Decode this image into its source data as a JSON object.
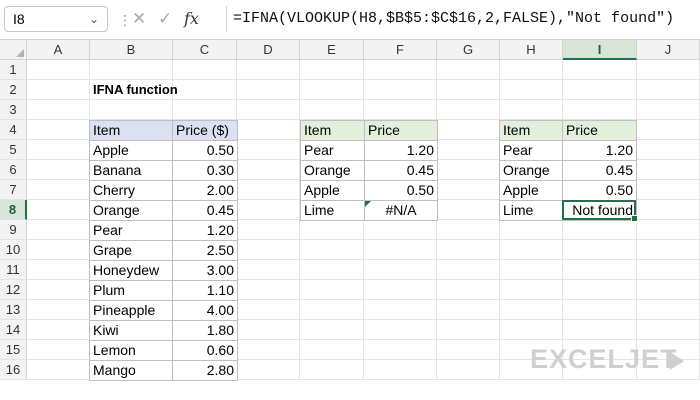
{
  "formula_bar": {
    "name_box": "I8",
    "name_box_icon": "chevron-down-icon",
    "cancel_icon": "x-icon",
    "enter_icon": "check-icon",
    "fx_icon": "fx",
    "formula": "=IFNA(VLOOKUP(H8,$B$5:$C$16,2,FALSE),\"Not found\")"
  },
  "columns": [
    "A",
    "B",
    "C",
    "D",
    "E",
    "F",
    "G",
    "H",
    "I",
    "J"
  ],
  "rows": [
    "1",
    "2",
    "3",
    "4",
    "5",
    "6",
    "7",
    "8",
    "9",
    "10",
    "11",
    "12",
    "13",
    "14",
    "15",
    "16"
  ],
  "active_cell": {
    "column": "I",
    "row": "8"
  },
  "sheet_title": "IFNA function",
  "table_prices": {
    "headers": [
      "Item",
      "Price ($)"
    ],
    "rows": [
      [
        "Apple",
        "0.50"
      ],
      [
        "Banana",
        "0.30"
      ],
      [
        "Cherry",
        "2.00"
      ],
      [
        "Orange",
        "0.45"
      ],
      [
        "Pear",
        "1.20"
      ],
      [
        "Grape",
        "2.50"
      ],
      [
        "Honeydew",
        "3.00"
      ],
      [
        "Plum",
        "1.10"
      ],
      [
        "Pineapple",
        "4.00"
      ],
      [
        "Kiwi",
        "1.80"
      ],
      [
        "Lemon",
        "0.60"
      ],
      [
        "Mango",
        "2.80"
      ]
    ]
  },
  "table_lookup": {
    "headers": [
      "Item",
      "Price"
    ],
    "rows": [
      [
        "Pear",
        "1.20"
      ],
      [
        "Orange",
        "0.45"
      ],
      [
        "Apple",
        "0.50"
      ],
      [
        "Lime",
        "#N/A"
      ]
    ]
  },
  "table_ifna": {
    "headers": [
      "Item",
      "Price"
    ],
    "rows": [
      [
        "Pear",
        "1.20"
      ],
      [
        "Orange",
        "0.45"
      ],
      [
        "Apple",
        "0.50"
      ],
      [
        "Lime",
        "Not found"
      ]
    ]
  },
  "watermark": "EXCELJET",
  "colors": {
    "accent": "#217346",
    "header_blue": "#d9e1f2",
    "header_green": "#e2efda",
    "grid": "#e4e4e4"
  }
}
